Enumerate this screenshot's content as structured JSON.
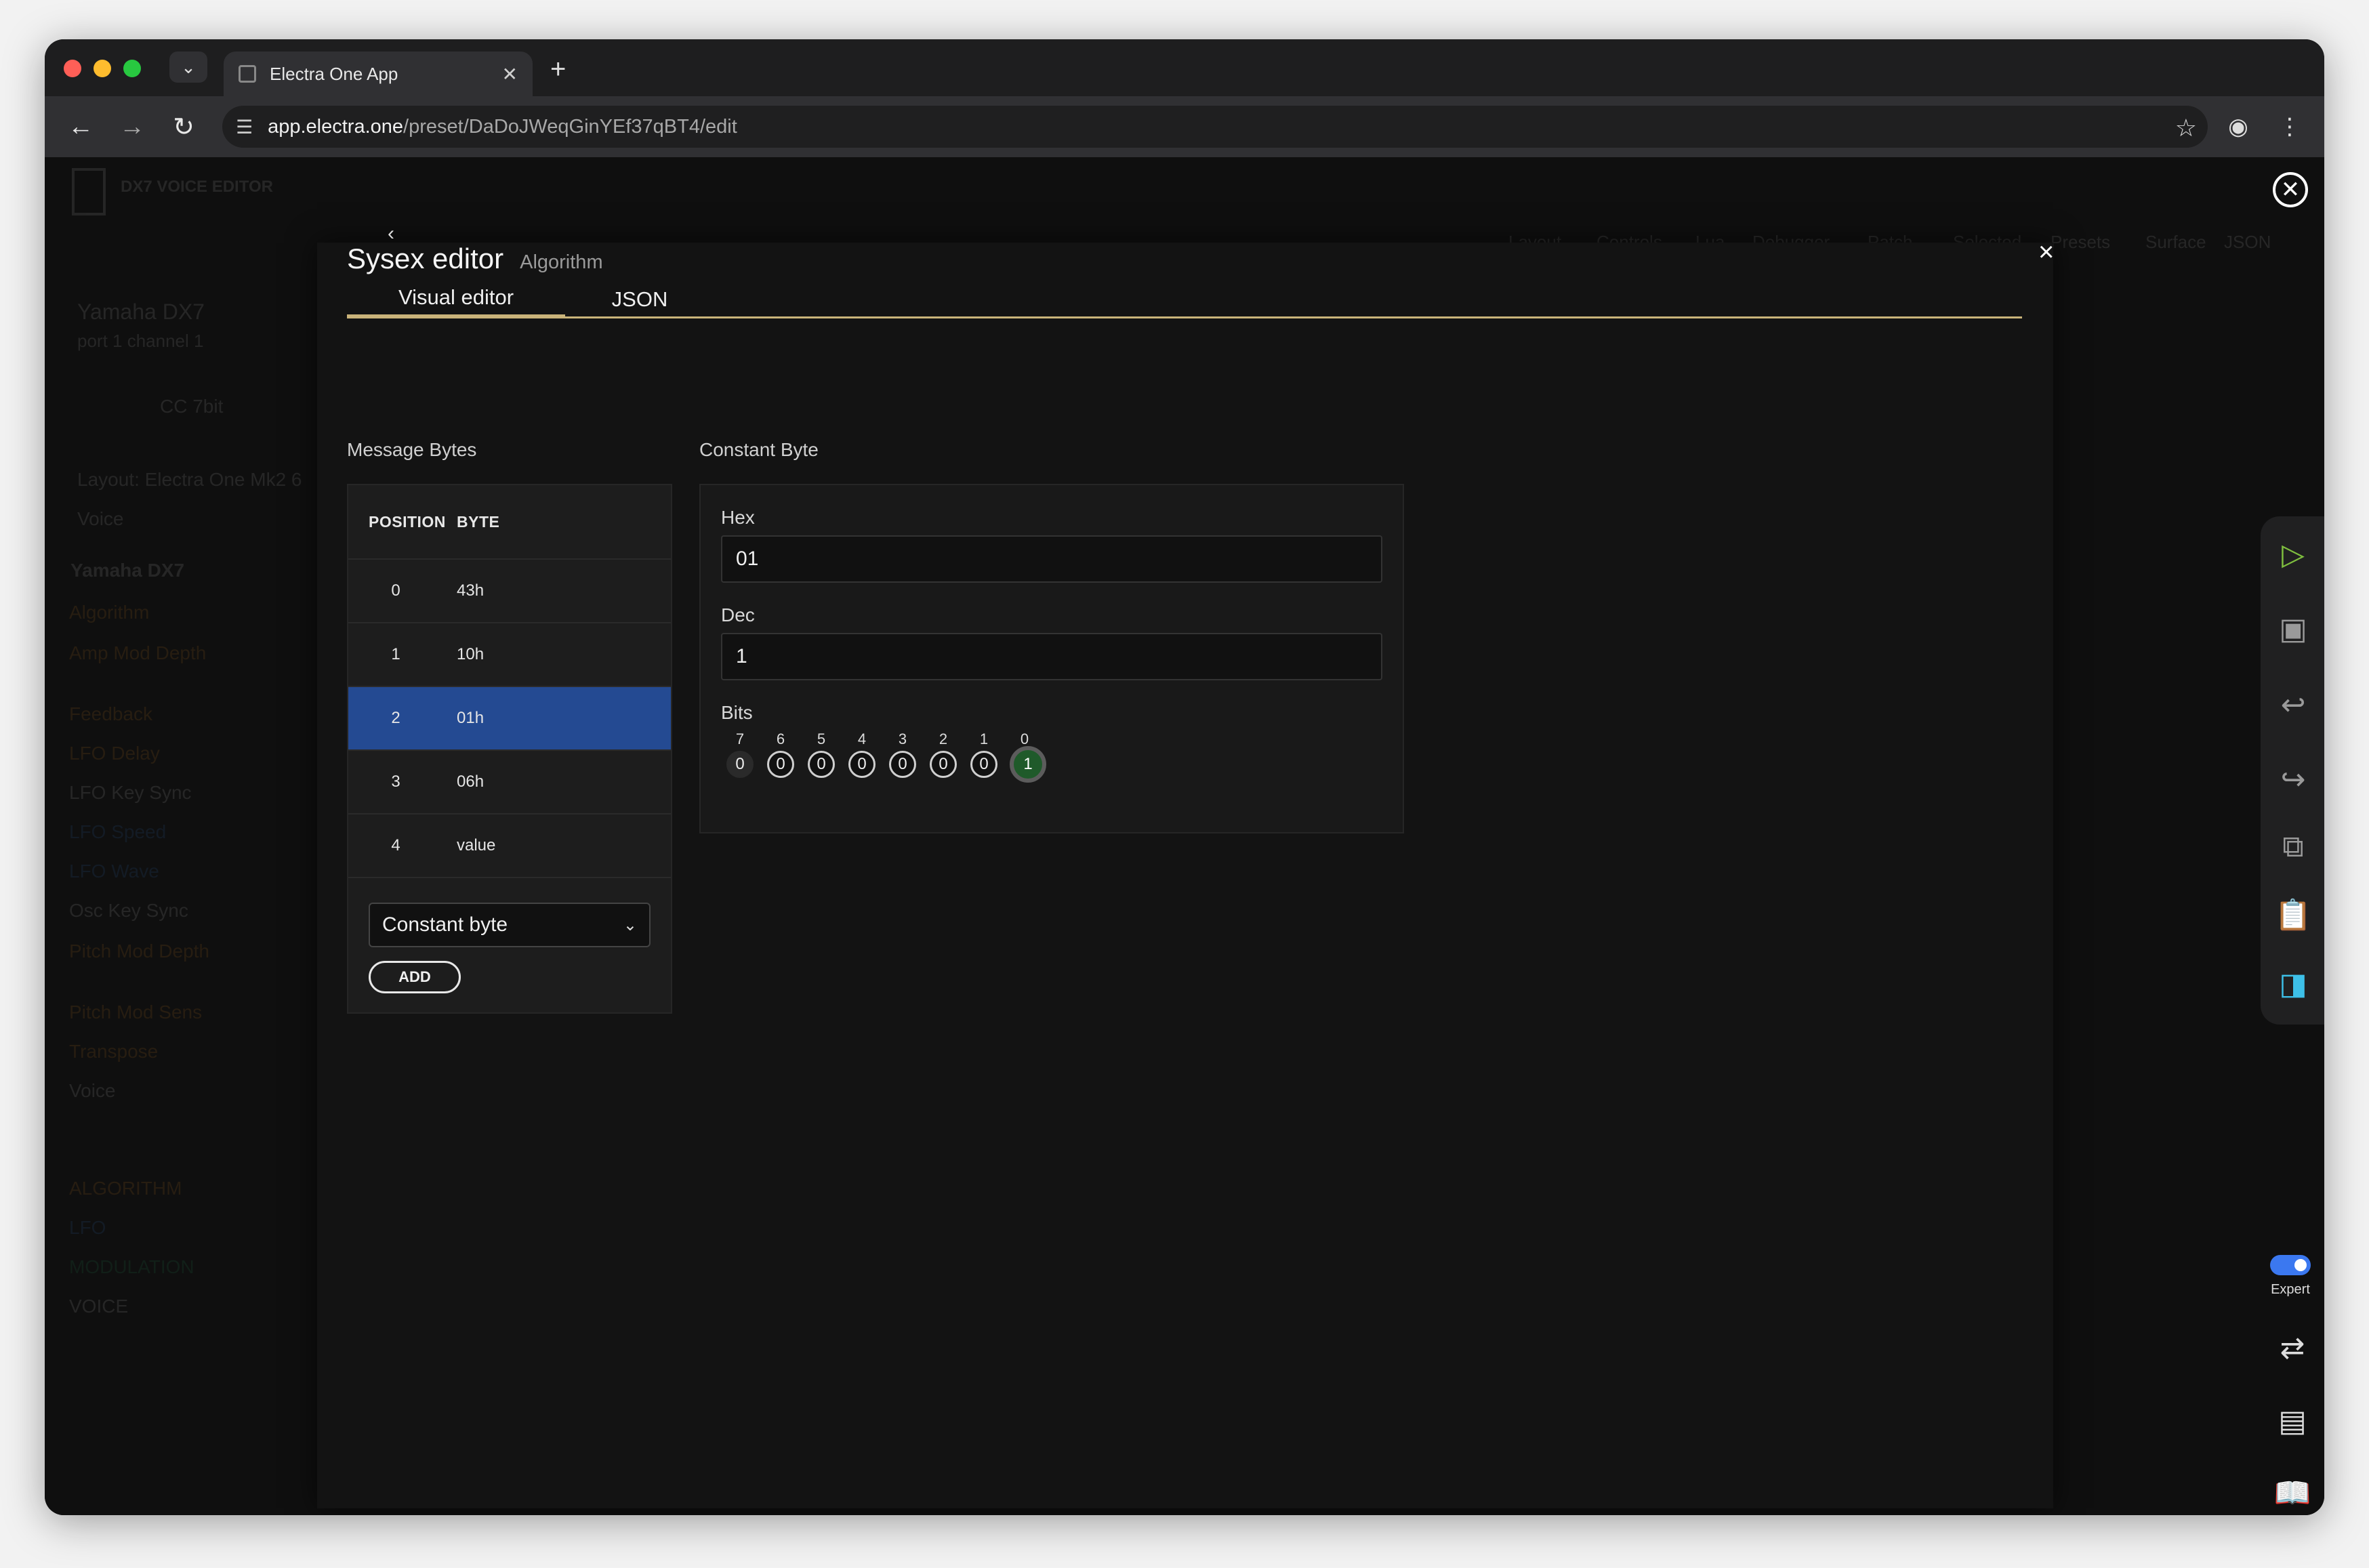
{
  "browser": {
    "tab_title": "Electra One App",
    "url_domain": "app.electra.one",
    "url_path": "/preset/DaDoJWeqGinYEf37qBT4/edit"
  },
  "background": {
    "app_name": "DX7 VOICE EDITOR",
    "device_name": "Yamaha DX7",
    "device_port": "port 1 channel 1",
    "control_type": "CC 7bit",
    "layout_label": "Layout: Electra One Mk2 6",
    "voice_label": "Voice",
    "group_title": "Yamaha DX7",
    "controls": [
      {
        "name": "Algorithm",
        "id": "#1"
      },
      {
        "name": "Amp Mod Depth",
        "id": "#4"
      },
      {
        "name": "Feedback",
        "id": "#2"
      },
      {
        "name": "LFO Delay",
        "id": "#3"
      },
      {
        "name": "LFO Key Sync",
        "id": "#9"
      },
      {
        "name": "LFO Speed",
        "id": "#4"
      },
      {
        "name": "LFO Wave",
        "id": "#8"
      },
      {
        "name": "Osc Key Sync",
        "id": "#8"
      },
      {
        "name": "Pitch Mod Depth",
        "id": "#10"
      },
      {
        "name": "Pitch Mod Sens",
        "id": "#11"
      },
      {
        "name": "Transpose",
        "id": "#3"
      },
      {
        "name": "Voice",
        "id": "#7"
      }
    ],
    "groups": [
      {
        "name": "ALGORITHM",
        "id": "#101"
      },
      {
        "name": "LFO",
        "id": "#102"
      },
      {
        "name": "MODULATION",
        "id": "#103"
      },
      {
        "name": "VOICE",
        "id": "#103"
      }
    ],
    "top_tabs": [
      "Layout",
      "Controls",
      "Lua",
      "Debugger",
      "Patch",
      "Selected",
      "Presets",
      "Surface",
      "JSON"
    ]
  },
  "modal": {
    "title": "Sysex editor",
    "subtitle": "Algorithm",
    "tabs": [
      "Visual editor",
      "JSON"
    ],
    "message_bytes_label": "Message Bytes",
    "constant_byte_label": "Constant Byte",
    "table_headers": [
      "POSITION",
      "BYTE"
    ],
    "rows": [
      {
        "position": "0",
        "byte": "43h"
      },
      {
        "position": "1",
        "byte": "10h"
      },
      {
        "position": "2",
        "byte": "01h"
      },
      {
        "position": "3",
        "byte": "06h"
      },
      {
        "position": "4",
        "byte": "value"
      }
    ],
    "selected_row": 2,
    "type_select_value": "Constant byte",
    "add_label": "ADD",
    "hex_label": "Hex",
    "hex_value": "01",
    "dec_label": "Dec",
    "dec_value": "1",
    "bits_label": "Bits",
    "bit_numbers": [
      "7",
      "6",
      "5",
      "4",
      "3",
      "2",
      "1",
      "0"
    ],
    "bit_values": [
      "0",
      "0",
      "0",
      "0",
      "0",
      "0",
      "0",
      "1"
    ]
  },
  "sidebar": {
    "expert_label": "Expert"
  },
  "colors": {
    "selected_row": "#244a92",
    "accent_tab": "#c9b37a",
    "bit_on": "#1f5a2a",
    "toggle": "#3b78f0"
  }
}
